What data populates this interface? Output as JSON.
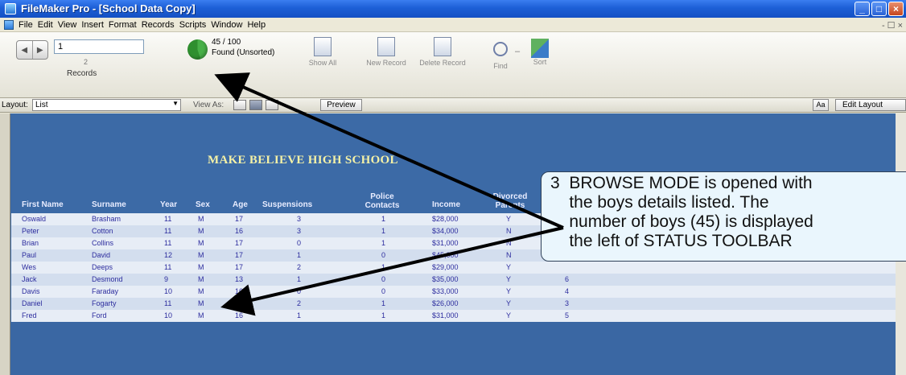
{
  "window": {
    "title": "FileMaker Pro - [School Data Copy]",
    "controls": [
      "minimize",
      "maximize",
      "close"
    ]
  },
  "menu": {
    "items": [
      "File",
      "Edit",
      "View",
      "Insert",
      "Format",
      "Records",
      "Scripts",
      "Window",
      "Help"
    ],
    "right_controls": "- ☐ ×"
  },
  "toolbar": {
    "record_value": "1",
    "record_sub": "2",
    "records_label": "Records",
    "found_count": "45 / 100",
    "found_text": "Found (Unsorted)",
    "buttons": [
      {
        "label": "Show All",
        "icon": "show-all-icon"
      },
      {
        "label": "New Record",
        "icon": "new-record-icon"
      },
      {
        "label": "Delete Record",
        "icon": "delete-record-icon"
      },
      {
        "label": "Find",
        "icon": "find-icon"
      },
      {
        "label": "Sort",
        "icon": "sort-icon"
      }
    ]
  },
  "layoutbar": {
    "layout_label": "Layout:",
    "layout_value": "List",
    "view_as_label": "View As:",
    "preview_label": "Preview",
    "aa_label": "Aa",
    "edit_layout_label": "Edit Layout"
  },
  "report": {
    "title": "MAKE BELIEVE HIGH SCHOOL",
    "columns": [
      "First Name",
      "Surname",
      "Year",
      "Sex",
      "Age",
      "Suspensions",
      "Police Contacts",
      "Income",
      "Divorced Parents",
      ""
    ],
    "rows": [
      [
        "Oswald",
        "Brasham",
        "11",
        "M",
        "17",
        "3",
        "1",
        "$28,000",
        "Y",
        ""
      ],
      [
        "Peter",
        "Cotton",
        "11",
        "M",
        "16",
        "3",
        "1",
        "$34,000",
        "N",
        ""
      ],
      [
        "Brian",
        "Collins",
        "11",
        "M",
        "17",
        "0",
        "1",
        "$31,000",
        "N",
        ""
      ],
      [
        "Paul",
        "David",
        "12",
        "M",
        "17",
        "1",
        "0",
        "$45,000",
        "N",
        ""
      ],
      [
        "Wes",
        "Deeps",
        "11",
        "M",
        "17",
        "2",
        "1",
        "$29,000",
        "Y",
        ""
      ],
      [
        "Jack",
        "Desmond",
        "9",
        "M",
        "13",
        "1",
        "0",
        "$35,000",
        "Y",
        "6"
      ],
      [
        "Davis",
        "Faraday",
        "10",
        "M",
        "16",
        "0",
        "0",
        "$33,000",
        "Y",
        "4"
      ],
      [
        "Daniel",
        "Fogarty",
        "11",
        "M",
        "17",
        "2",
        "1",
        "$26,000",
        "Y",
        "3"
      ],
      [
        "Fred",
        "Ford",
        "10",
        "M",
        "16",
        "1",
        "1",
        "$31,000",
        "Y",
        "5"
      ]
    ]
  },
  "callout": {
    "text": "3  BROWSE MODE is opened with\n    the boys details listed. The\n    number of boys (45) is displayed\n    the left of STATUS TOOLBAR"
  }
}
